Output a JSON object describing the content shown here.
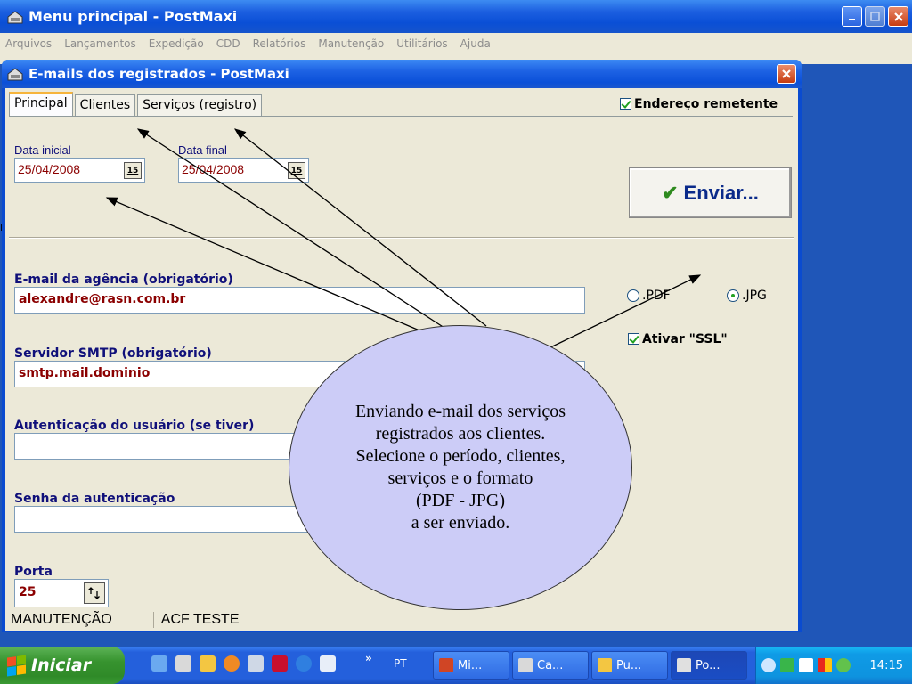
{
  "main_window": {
    "title": "Menu principal - PostMaxi",
    "menu": [
      "Arquivos",
      "Lançamentos",
      "Expedição",
      "CDD",
      "Relatórios",
      "Manutenção",
      "Utilitários",
      "Ajuda"
    ],
    "edge_char": "r"
  },
  "dialog": {
    "title": "E-mails dos registrados - PostMaxi",
    "tabs": [
      "Principal",
      "Clientes",
      "Serviços (registro)"
    ],
    "active_tab": "Principal",
    "endereco_remetente": {
      "label": "Endereço remetente",
      "checked": true
    },
    "data_inicial": {
      "label": "Data inicial",
      "value": "25/04/2008",
      "cal_glyph": "15"
    },
    "data_final": {
      "label": "Data final",
      "value": "25/04/2008",
      "cal_glyph": "15"
    },
    "enviar_label": "Enviar...",
    "email_agencia": {
      "label": "E-mail da agência (obrigatório)",
      "value": "alexandre@rasn.com.br"
    },
    "format_options": [
      {
        "label": ".PDF",
        "selected": false
      },
      {
        "label": ".JPG",
        "selected": true
      }
    ],
    "servidor_smtp": {
      "label": "Servidor SMTP (obrigatório)",
      "value": "smtp.mail.dominio"
    },
    "ativar_ssl": {
      "label": "Ativar \"SSL\"",
      "checked": true
    },
    "autenticacao": {
      "label": "Autenticação do usuário (se tiver)",
      "value": ""
    },
    "senha": {
      "label": "Senha da autenticação",
      "value": ""
    },
    "porta": {
      "label": "Porta",
      "value": "25"
    },
    "status": [
      "MANUTENÇÃO",
      "ACF TESTE"
    ]
  },
  "callout": {
    "text": "Enviando e-mail dos serviços\nregistrados aos clientes.\nSelecione o período,  clientes,\nserviços e o formato\n(PDF - JPG)\na ser enviado."
  },
  "taskbar": {
    "start_label": "Iniciar",
    "language": "PT",
    "chevron": "»",
    "tasks": [
      "Mi...",
      "Ca...",
      "Pu...",
      "Po..."
    ],
    "active_task": "Po...",
    "clock": "14:15"
  },
  "colors": {
    "xp_blue": "#0a4fd6",
    "dialog_face": "#ece9d8",
    "field_text": "#8b0000",
    "label_blue": "#10107a",
    "callout_fill": "#ccccf7",
    "start_green": "#37932f"
  },
  "icons": {
    "app": "mailbox-icon",
    "check": "green-checkmark-icon",
    "calendar": "calendar-icon",
    "spinner": "up-down-spinner-icon"
  }
}
